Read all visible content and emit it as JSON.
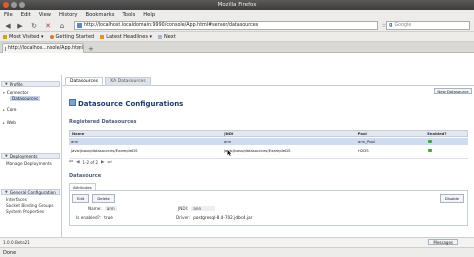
{
  "window": {
    "title": "Mozilla Firefox"
  },
  "menu": [
    "File",
    "Edit",
    "View",
    "History",
    "Bookmarks",
    "Tools",
    "Help"
  ],
  "nav": {
    "url": "http://localhost.localdomain:9990/console/App.html#server/datasources",
    "search_placeholder": "Google"
  },
  "bookmarks": [
    {
      "label": "Most Visited ▾",
      "icon": "star-icon"
    },
    {
      "label": "Getting Started",
      "icon": "firefox-icon"
    },
    {
      "label": "Latest Headlines ▾",
      "icon": "rss-icon"
    },
    {
      "label": "Next",
      "icon": "page-icon"
    }
  ],
  "tab": {
    "label": "http://localhos...nsole/App.html"
  },
  "console": {
    "module_tabs": [
      "Datasources",
      "XA Datasources"
    ],
    "sidebar": {
      "groups": [
        {
          "label": "Profile"
        },
        {
          "label": "Deployments"
        },
        {
          "label": "General Configuration"
        }
      ],
      "items": [
        {
          "label": "Connector"
        },
        {
          "label": "Datasources"
        },
        {
          "label": "Core"
        },
        {
          "label": "Web"
        }
      ],
      "deploy_links": [
        "Manage Deployments"
      ],
      "general_links": [
        "Interfaces",
        "Socket Binding Groups",
        "System Properties"
      ]
    },
    "new_button": "New Datasource",
    "page_title": "Datasource Configurations",
    "registered_title": "Registered Datasources",
    "table": {
      "headers": [
        "Name",
        "JNDI",
        "Pool",
        "Enabled?"
      ],
      "rows": [
        {
          "name": "ann",
          "jndi": "ann",
          "pool": "ann_Pool",
          "enabled": true
        },
        {
          "name": "java:jboss/datasources/ExampleDS",
          "jndi": "java:jboss/datasources/ExampleDS",
          "pool": "H2DS",
          "enabled": true
        }
      ],
      "pager": "1-2 of 2"
    },
    "detail_title": "Datasource",
    "detail_tab": "Attributes",
    "buttons": {
      "edit": "Edit",
      "delete": "Delete",
      "disable": "Disable"
    },
    "form": {
      "name_label": "Name:",
      "name_value": "ann",
      "jndi_label": "JNDI:",
      "jndi_value": "ann",
      "enabled_label": "Is enabled?:",
      "enabled_value": "true",
      "driver_label": "Driver:",
      "driver_value": "postgresql-8.4-702.jdbc4.jar"
    },
    "version": "1.0.0.Beta21",
    "messages_button": "Messages"
  },
  "status": "Done"
}
